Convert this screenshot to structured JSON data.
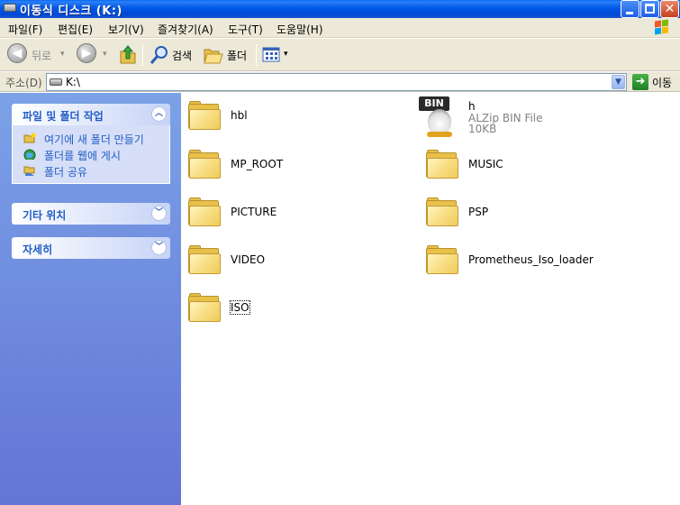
{
  "window": {
    "title": "이동식 디스크 (K:)",
    "close_glyph": "✕"
  },
  "menu": {
    "items": [
      "파일(F)",
      "편집(E)",
      "보기(V)",
      "즐겨찾기(A)",
      "도구(T)",
      "도움말(H)"
    ]
  },
  "toolbar": {
    "back_label": "뒤로",
    "search_label": "검색",
    "folders_label": "폴더"
  },
  "address": {
    "label": "주소(D)",
    "value": "K:\\",
    "go_label": "이동"
  },
  "task_pane": {
    "file_folder_tasks": {
      "title": "파일 및 폴더 작업",
      "tasks": [
        "여기에 새 폴더 만들기",
        "폴더를 웹에 게시",
        "폴더 공유"
      ]
    },
    "other_places": {
      "title": "기타 위치"
    },
    "details": {
      "title": "자세히"
    }
  },
  "items": [
    {
      "name": "hbl",
      "type": "folder"
    },
    {
      "name": "h",
      "type": "file",
      "file_type": "ALZip BIN File",
      "size": "10KB",
      "icon_text": "BIN"
    },
    {
      "name": "MP_ROOT",
      "type": "folder"
    },
    {
      "name": "MUSIC",
      "type": "folder"
    },
    {
      "name": "PICTURE",
      "type": "folder"
    },
    {
      "name": "PSP",
      "type": "folder"
    },
    {
      "name": "VIDEO",
      "type": "folder"
    },
    {
      "name": "Prometheus_Iso_loader",
      "type": "folder"
    },
    {
      "name": "ISO",
      "type": "folder"
    }
  ],
  "colors": {
    "titlebar": "#0058e6",
    "taskpane_top": "#7ba2e7",
    "taskpane_bottom": "#6375d6",
    "task_link": "#215dc6",
    "folder_yellow": "#f9e08a"
  }
}
